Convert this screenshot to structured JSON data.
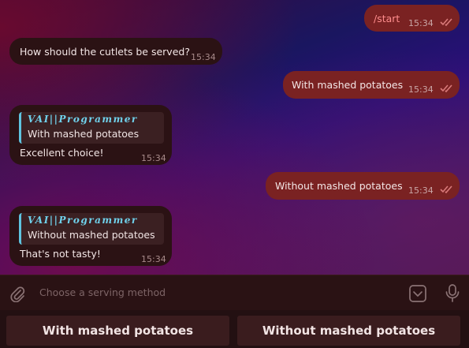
{
  "colors": {
    "outgoing_bubble": "#7a2222",
    "incoming_bubble": "#2b1214",
    "quote_accent": "#5fc4e0",
    "composer_bg": "#2a1214",
    "keyboard_button_bg": "#3a1c1e"
  },
  "messages": [
    {
      "direction": "out",
      "text": "/start",
      "time": "15:34",
      "read": true
    },
    {
      "direction": "in",
      "text": "How should the cutlets be served?",
      "time": "15:34"
    },
    {
      "direction": "out",
      "text": "With mashed potatoes",
      "time": "15:34",
      "read": true
    },
    {
      "direction": "in",
      "quote_title": "VAI||Programmer",
      "quote_text": "With mashed potatoes",
      "text": "Excellent choice!",
      "time": "15:34"
    },
    {
      "direction": "out",
      "text": "Without mashed potatoes",
      "time": "15:34",
      "read": true
    },
    {
      "direction": "in",
      "quote_title": "VAI||Programmer",
      "quote_text": "Without mashed potatoes",
      "text": "That's not tasty!",
      "time": "15:34"
    }
  ],
  "composer": {
    "placeholder": "Choose a serving method",
    "attach_icon": "paperclip-icon",
    "keyboard_toggle_icon": "keyboard-toggle-icon",
    "mic_icon": "microphone-icon"
  },
  "keyboard": {
    "buttons": [
      "With mashed potatoes",
      "Without mashed potatoes"
    ]
  }
}
